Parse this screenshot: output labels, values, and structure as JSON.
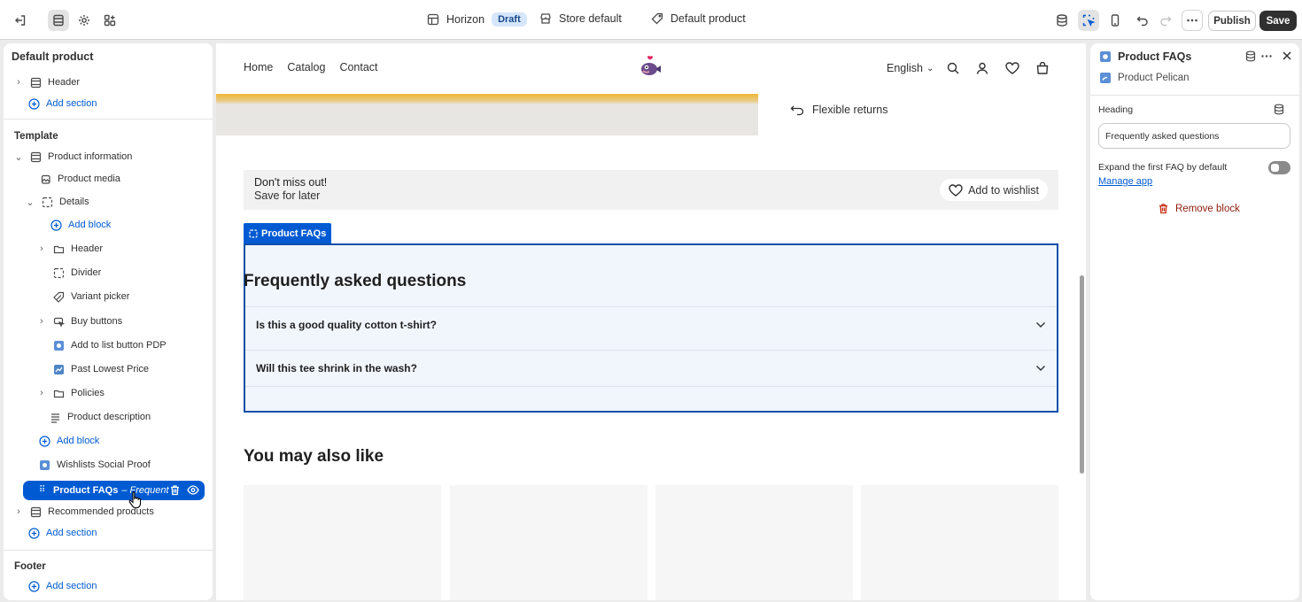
{
  "topbar": {
    "theme_name": "Horizon",
    "theme_badge": "Draft",
    "store_label": "Store default",
    "product_label": "Default product",
    "publish_label": "Publish",
    "save_label": "Save"
  },
  "sidebar": {
    "title": "Default product",
    "header_label": "Header",
    "add_section": "Add section",
    "template_label": "Template",
    "product_information": "Product information",
    "product_media": "Product media",
    "details": "Details",
    "add_block": "Add block",
    "sub_header": "Header",
    "divider": "Divider",
    "variant_picker": "Variant picker",
    "buy_buttons": "Buy buttons",
    "add_to_list": "Add to list button PDP",
    "past_lowest": "Past Lowest Price",
    "policies": "Policies",
    "product_description": "Product description",
    "add_block_2": "Add block",
    "wishlists": "Wishlists Social Proof",
    "selected_name": "Product FAQs",
    "selected_suffix": "– Frequent",
    "recommended": "Recommended products",
    "add_section_2": "Add section",
    "footer_label": "Footer",
    "add_section_3": "Add section"
  },
  "store": {
    "nav": [
      "Home",
      "Catalog",
      "Contact"
    ],
    "language": "English",
    "flexible_returns": "Flexible returns",
    "wish_title": "Don't miss out!",
    "wish_sub": "Save for later",
    "wish_button": "Add to wishlist",
    "faq_tag": "Product FAQs",
    "faq_heading": "Frequently asked questions",
    "faq_q1": "Is this a good quality cotton t-shirt?",
    "faq_q2": "Will this tee shrink in the wash?",
    "ymal": "You may also like"
  },
  "inspector": {
    "title": "Product FAQs",
    "app_name": "Product Pelican",
    "heading_label": "Heading",
    "heading_value": "Frequently asked questions",
    "expand_label": "Expand the first FAQ by default",
    "expand_on": false,
    "manage_app": "Manage app",
    "remove_block": "Remove block"
  },
  "colors": {
    "accent": "#005bd3",
    "danger": "#8e1f0b"
  }
}
